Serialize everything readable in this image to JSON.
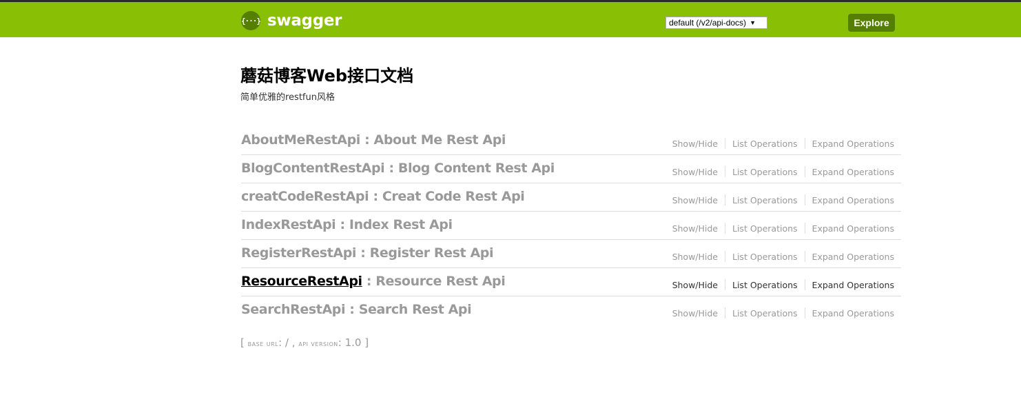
{
  "header": {
    "logo_text": "swagger",
    "logo_icon": "swagger-braces-icon",
    "logo_icon_glyph": "{···}",
    "spec_select": {
      "selected": "default (/v2/api-docs)",
      "arrow": "▼"
    },
    "explore_label": "Explore",
    "colors": {
      "bar": "#89bf04",
      "accent": "#547f00"
    }
  },
  "info": {
    "title": "蘑菇博客Web接口文档",
    "description": "简单优雅的restfun风格"
  },
  "resources": [
    {
      "name": "AboutMeRestApi",
      "description": " : About Me Rest Api",
      "show_hide": "Show/Hide",
      "list_ops": "List Operations",
      "expand_ops": "Expand Operations"
    },
    {
      "name": "BlogContentRestApi",
      "description": " : Blog Content Rest Api",
      "show_hide": "Show/Hide",
      "list_ops": "List Operations",
      "expand_ops": "Expand Operations"
    },
    {
      "name": "creatCodeRestApi",
      "description": " : Creat Code Rest Api",
      "show_hide": "Show/Hide",
      "list_ops": "List Operations",
      "expand_ops": "Expand Operations"
    },
    {
      "name": "IndexRestApi",
      "description": " : Index Rest Api",
      "show_hide": "Show/Hide",
      "list_ops": "List Operations",
      "expand_ops": "Expand Operations"
    },
    {
      "name": "RegisterRestApi",
      "description": " : Register Rest Api",
      "show_hide": "Show/Hide",
      "list_ops": "List Operations",
      "expand_ops": "Expand Operations"
    },
    {
      "name": "ResourceRestApi",
      "description": " : Resource Rest Api",
      "show_hide": "Show/Hide",
      "list_ops": "List Operations",
      "expand_ops": "Expand Operations",
      "hovered": true
    },
    {
      "name": "SearchRestApi",
      "description": " : Search Rest Api",
      "show_hide": "Show/Hide",
      "list_ops": "List Operations",
      "expand_ops": "Expand Operations"
    }
  ],
  "footer": {
    "open": "[ ",
    "base_url_label": "base url",
    "base_url_value": ": / , ",
    "api_version_label": "api version",
    "api_version_value": ": 1.0 ]"
  }
}
